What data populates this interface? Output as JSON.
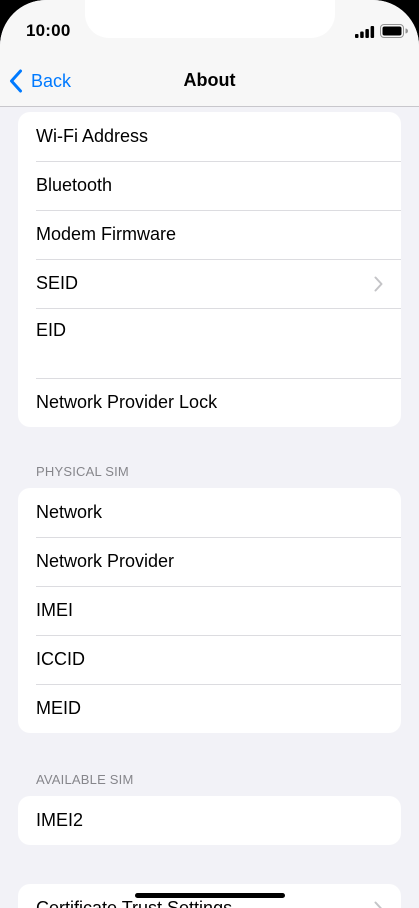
{
  "status_bar": {
    "time": "10:00"
  },
  "nav": {
    "back_label": "Back",
    "title": "About"
  },
  "group1": {
    "rows": [
      {
        "label": "Wi-Fi Address"
      },
      {
        "label": "Bluetooth"
      },
      {
        "label": "Modem Firmware"
      },
      {
        "label": "SEID"
      },
      {
        "label": "EID"
      },
      {
        "label": "Network Provider Lock"
      }
    ]
  },
  "physical_sim": {
    "header": "PHYSICAL SIM",
    "rows": [
      {
        "label": "Network"
      },
      {
        "label": "Network Provider"
      },
      {
        "label": "IMEI"
      },
      {
        "label": "ICCID"
      },
      {
        "label": "MEID"
      }
    ]
  },
  "available_sim": {
    "header": "AVAILABLE SIM",
    "rows": [
      {
        "label": "IMEI2"
      }
    ]
  },
  "group4": {
    "rows": [
      {
        "label": "Certificate Trust Settings"
      }
    ]
  },
  "icons": {
    "back": "chevron-left-icon",
    "disclosure": "chevron-right-icon",
    "signal": "signal-icon",
    "battery": "battery-icon"
  },
  "colors": {
    "accent": "#007aff",
    "background": "#f2f2f7",
    "section_header": "#86868b"
  }
}
